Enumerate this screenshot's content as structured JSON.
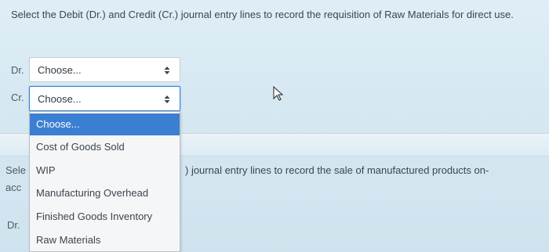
{
  "question1": {
    "text": "Select the Debit (Dr.) and Credit (Cr.) journal entry lines to record the requisition of Raw Materials for direct use."
  },
  "debit_row": {
    "label": "Dr.",
    "selected": "Choose..."
  },
  "credit_row": {
    "label": "Cr.",
    "selected": "Choose..."
  },
  "dropdown": {
    "options": [
      "Choose...",
      "Cost of Goods Sold",
      "WIP",
      "Manufacturing Overhead",
      "Finished Goods Inventory",
      "Raw Materials"
    ],
    "highlighted_index": 0
  },
  "question2": {
    "fragment_start_1": "Sele",
    "fragment_start_2": "acc",
    "fragment_end": ") journal entry lines to record the sale of manufactured products on-",
    "debit_label": "Dr."
  },
  "colors": {
    "highlight": "#3b7fd2",
    "background": "#d6e8f2"
  }
}
